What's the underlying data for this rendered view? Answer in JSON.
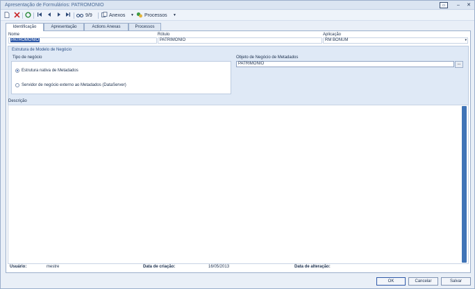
{
  "window": {
    "title": "Apresentação de Formulários: PATROMONIO",
    "controls": {
      "restore": "▭",
      "minimize": "–",
      "close": "✕"
    }
  },
  "toolbar": {
    "record_position": "9/9",
    "attachments_label": "Anexos",
    "processes_label": "Processos",
    "icons": [
      "new-icon",
      "delete-icon",
      "refresh-icon",
      "first-record-icon",
      "previous-record-icon",
      "next-record-icon",
      "last-record-icon",
      "search-icon",
      "attachments-icon",
      "processes-icon"
    ]
  },
  "tabs": [
    {
      "label": "Identificação",
      "active": true
    },
    {
      "label": "Apresentação",
      "active": false
    },
    {
      "label": "Actions Anexas",
      "active": false
    },
    {
      "label": "Processos",
      "active": false
    }
  ],
  "form": {
    "name_label": "Nome",
    "name_value": "PATROMONIO",
    "rotulo_label": "Rótulo",
    "rotulo_value": "PATRIMONIO",
    "aplicacao_label": "Aplicação",
    "aplicacao_value": "RM BONUM"
  },
  "model_group": {
    "title": "Estrutura de Modelo de Negócio",
    "business_type_label": "Tipo de negócio",
    "option_native": "Estrutura nativa de Metadados",
    "option_external": "Servidor de negócio externo ao Metadados (DataServer)",
    "metadata_object_label": "Objeto de Negócio de Metadados",
    "metadata_object_value": "PATRIMONIO",
    "browse_label": "..."
  },
  "description": {
    "label": "Descrição",
    "value": ""
  },
  "footer": {
    "user_label": "Usuário:",
    "user_value": "mestre",
    "created_label": "Data de criação:",
    "created_value": "16/05/2013",
    "modified_label": "Data de alteração:",
    "modified_value": ""
  },
  "buttons": {
    "ok": "OK",
    "cancel": "Cancelar",
    "save": "Salvar"
  }
}
